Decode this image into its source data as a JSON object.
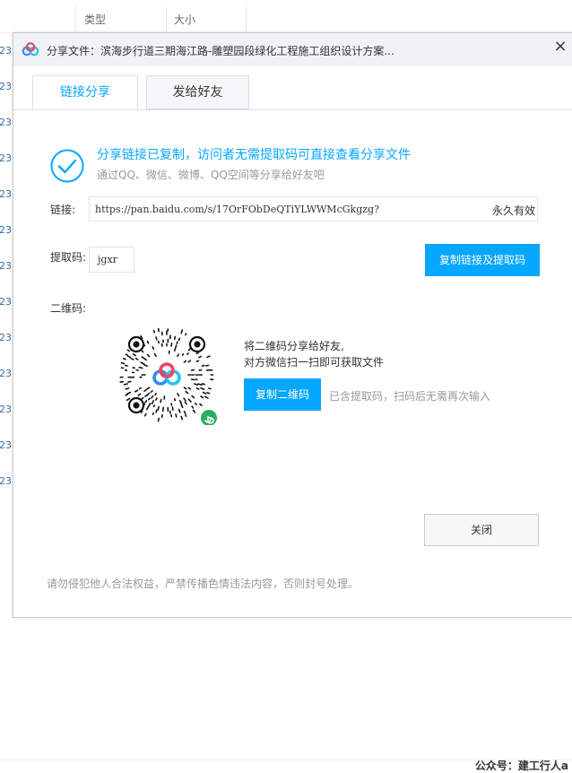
{
  "background": {
    "col_type": "类型",
    "col_size": "大小",
    "row_fragments": [
      "23",
      "23",
      "23",
      "23",
      "23",
      "23",
      "23",
      "23",
      "23",
      "23",
      "23",
      "23",
      "23"
    ],
    "watermark": "公众号：建工行人a"
  },
  "dialog": {
    "title": "分享文件：滨海步行道三期海江路-雕塑园段绿化工程施工组织设计方案...",
    "close_glyph": "×",
    "tabs": [
      {
        "label": "链接分享",
        "active": true
      },
      {
        "label": "发给好友",
        "active": false
      }
    ],
    "success_title": "分享链接已复制，访问者无需提取码可直接查看分享文件",
    "success_sub": "通过QQ、微信、微博、QQ空间等分享给好友吧",
    "link_label": "链接:",
    "link_value": "https://pan.baidu.com/s/17OrFObDeQTiYLWWMcGkgzg?",
    "expire_text": "永久有效",
    "code_label": "提取码:",
    "code_value": "jgxr",
    "copy_link_button": "复制链接及提取码",
    "qr_label": "二维码:",
    "qr_line1": "将二维码分享给好友,",
    "qr_line2": "对方微信扫一扫即可获取文件",
    "copy_qr_button": "复制二维码",
    "qr_note": "已含提取码，扫码后无需再次输入",
    "close_button": "关闭",
    "footer": "请勿侵犯他人合法权益，严禁传播色情违法内容，否则封号处理。"
  },
  "colors": {
    "accent": "#06a7ff",
    "muted_text": "#999999",
    "titlebar_bg": "#f0f2f5",
    "wechat_green": "#2aae67"
  },
  "icons": [
    "baidu-netdisk-logo-icon",
    "close-icon",
    "check-circle-icon",
    "qr-code-icon",
    "wechat-miniprogram-icon"
  ]
}
